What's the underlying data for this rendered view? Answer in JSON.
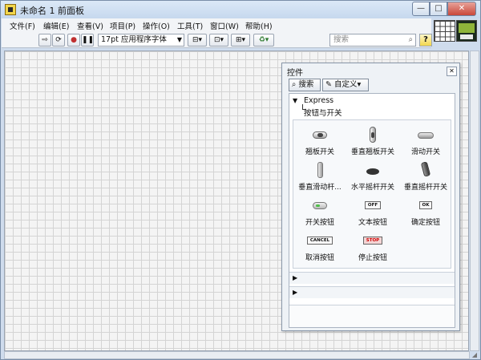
{
  "window": {
    "title": "未命名 1 前面板"
  },
  "menu": [
    "文件(F)",
    "编辑(E)",
    "查看(V)",
    "项目(P)",
    "操作(O)",
    "工具(T)",
    "窗口(W)",
    "帮助(H)"
  ],
  "toolbar": {
    "font": "17pt 应用程序字体",
    "search_placeholder": "搜索",
    "help_label": "?"
  },
  "palette": {
    "title": "控件",
    "search_label": "搜索",
    "customize_label": "自定义▾",
    "category": "Express",
    "subcategory": "按钮与开关",
    "items": [
      {
        "label": "翘板开关",
        "icon": "toggle-switch-icon"
      },
      {
        "label": "垂直翘板开关",
        "icon": "vertical-toggle-switch-icon"
      },
      {
        "label": "滑动开关",
        "icon": "slide-switch-icon"
      },
      {
        "label": "垂直滑动杆...",
        "icon": "vertical-slide-switch-icon"
      },
      {
        "label": "水平摇杆开关",
        "icon": "horizontal-rocker-switch-icon"
      },
      {
        "label": "垂直摇杆开关",
        "icon": "vertical-rocker-switch-icon"
      },
      {
        "label": "开关按钮",
        "icon": "push-button-icon"
      },
      {
        "label": "文本按钮",
        "icon": "text-button-icon",
        "text": "OFF"
      },
      {
        "label": "确定按钮",
        "icon": "ok-button-icon",
        "text": "OK"
      },
      {
        "label": "取消按钮",
        "icon": "cancel-button-icon",
        "text": "CANCEL"
      },
      {
        "label": "停止按钮",
        "icon": "stop-button-icon",
        "text": "STOP"
      }
    ]
  }
}
